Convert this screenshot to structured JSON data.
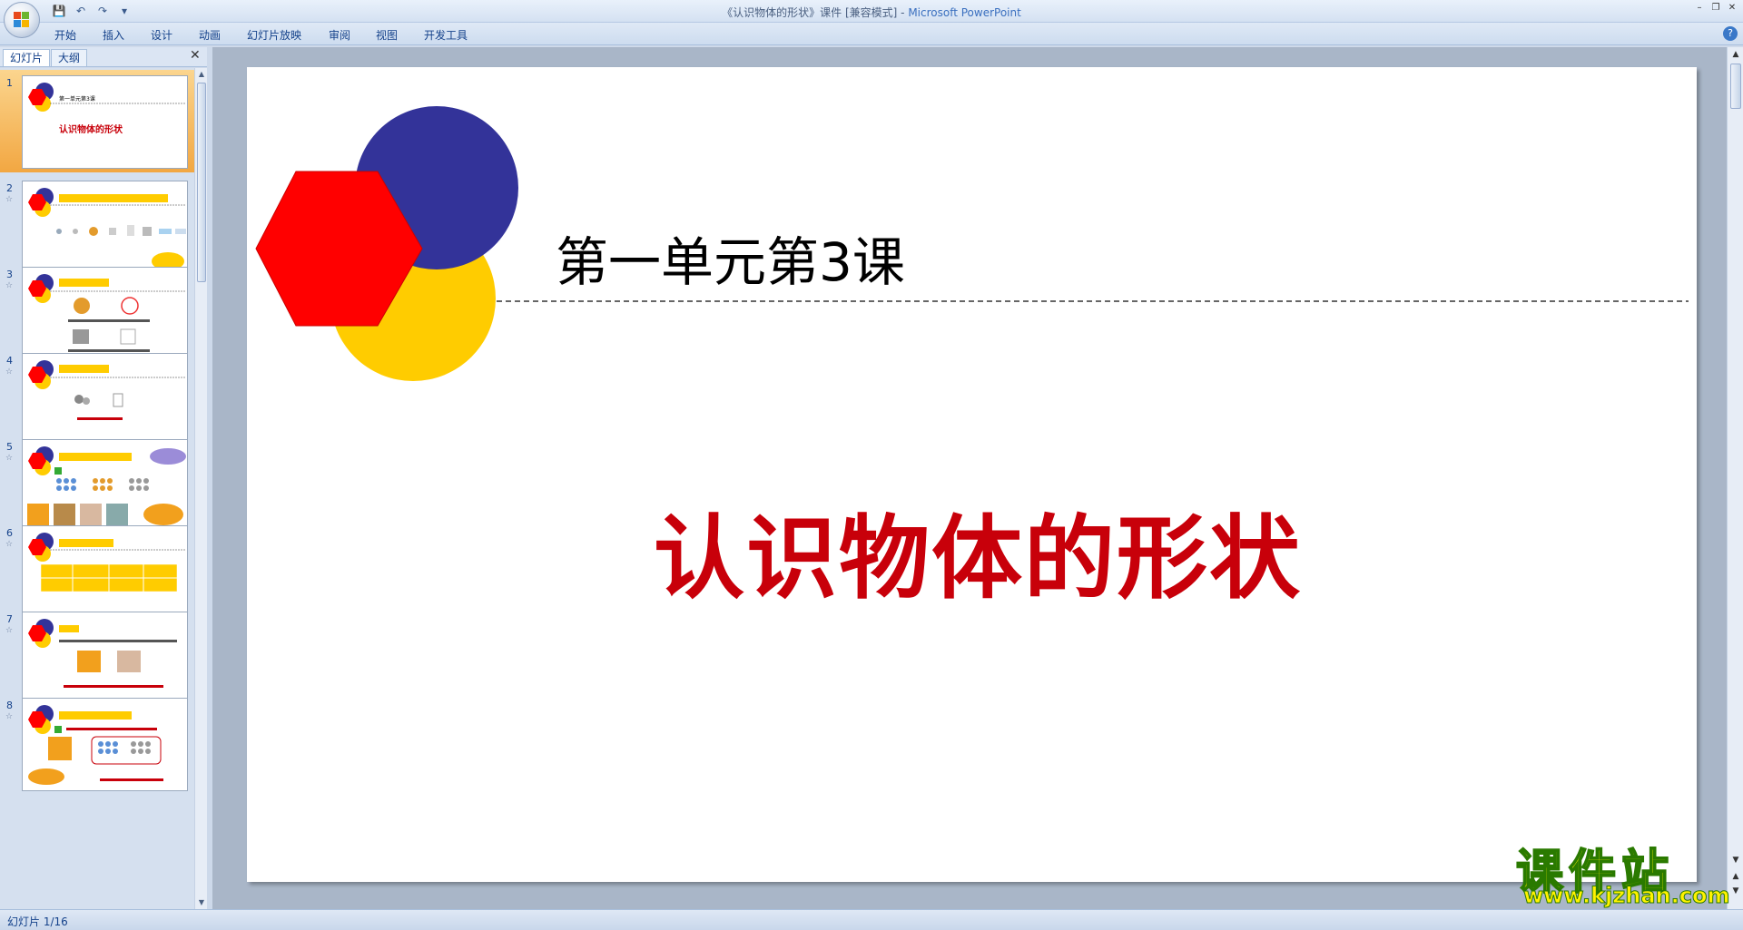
{
  "window": {
    "title": "《认识物体的形状》课件 [兼容模式] - ",
    "app": "Microsoft PowerPoint"
  },
  "ribbon": {
    "tabs": [
      "开始",
      "插入",
      "设计",
      "动画",
      "幻灯片放映",
      "审阅",
      "视图",
      "开发工具"
    ]
  },
  "pane": {
    "tab_slides": "幻灯片",
    "tab_outline": "大纲"
  },
  "thumbnails": [
    {
      "num": "1",
      "title": "第一单元第3课",
      "main": "认识物体的形状",
      "has_effect": false
    },
    {
      "num": "2",
      "title": "",
      "has_effect": true
    },
    {
      "num": "3",
      "title": "",
      "has_effect": true
    },
    {
      "num": "4",
      "title": "",
      "has_effect": true
    },
    {
      "num": "5",
      "title": "",
      "has_effect": true
    },
    {
      "num": "6",
      "title": "",
      "has_effect": true
    },
    {
      "num": "7",
      "title": "",
      "has_effect": true
    },
    {
      "num": "8",
      "title": "",
      "has_effect": true
    }
  ],
  "slide": {
    "subtitle": "第一单元第3课",
    "title": "认识物体的形状"
  },
  "status": {
    "text": "幻灯片 1/16"
  },
  "watermark": {
    "big": "课件站",
    "url": "www.kjzhan.com"
  },
  "colors": {
    "red": "#ff0000",
    "blue": "#333399",
    "yellow": "#ffcc00",
    "title_red": "#c8000a"
  }
}
